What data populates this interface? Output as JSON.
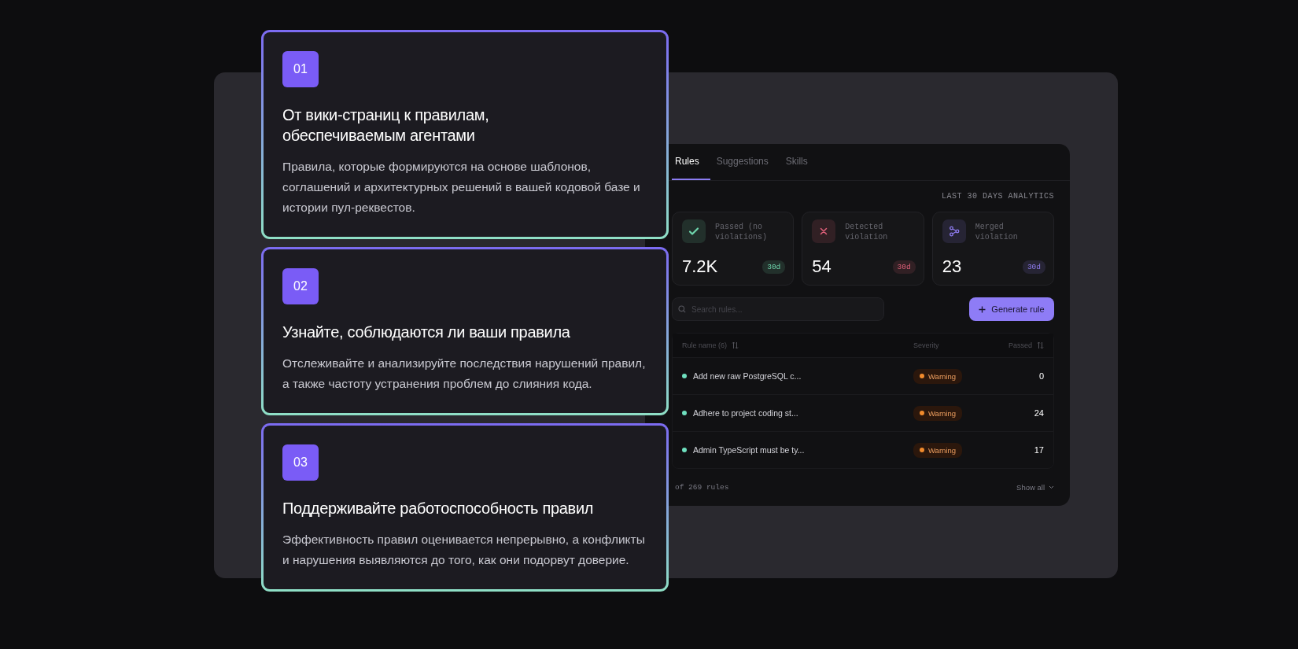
{
  "features": [
    {
      "number": "01",
      "title": "От вики-страниц к правилам, обеспечиваемым агентами",
      "text": "Правила, которые формируются на основе шаблонов, соглашений и архитектурных решений в вашей кодовой базе и истории пул-реквестов."
    },
    {
      "number": "02",
      "title": "Узнайте, соблюдаются ли ваши правила",
      "text": "Отслеживайте и анализируйте последствия нарушений правил, а также частоту устранения проблем до слияния кода."
    },
    {
      "number": "03",
      "title": "Поддерживайте работоспособность правил",
      "text": "Эффективность правил оценивается непрерывно, а конфликты и нарушения выявляются до того, как они подорвут доверие."
    }
  ],
  "dashboard": {
    "tabs": [
      {
        "label": "Rules",
        "selected": true
      },
      {
        "label": "Suggestions",
        "selected": false
      },
      {
        "label": "Skills",
        "selected": false
      }
    ],
    "analytics_label": "LAST 30 DAYS ANALYTICS",
    "stats": [
      {
        "kind": "passed",
        "label": "Passed (no violations)",
        "value": "7.2K",
        "period": "30d",
        "color": "#6fd6ad"
      },
      {
        "kind": "detected",
        "label": "Detected violation",
        "value": "54",
        "period": "30d",
        "color": "#e0607a"
      },
      {
        "kind": "merged",
        "label": "Merged violation",
        "value": "23",
        "period": "30d",
        "color": "#8f7cf0"
      }
    ],
    "search": {
      "placeholder": "Search rules..."
    },
    "generate_button": "Generate rule",
    "table": {
      "columns": [
        "Rule name (6)",
        "Severity",
        "Passed"
      ],
      "rows": [
        {
          "name": "Add new raw PostgreSQL c...",
          "severity": "Warning",
          "passed": "0"
        },
        {
          "name": "Adhere to project coding st...",
          "severity": "Warning",
          "passed": "24"
        },
        {
          "name": "Admin TypeScript must be ty...",
          "severity": "Warning",
          "passed": "17"
        }
      ]
    },
    "footer": {
      "count": "of 269 rules",
      "show_all": "Show all"
    }
  }
}
